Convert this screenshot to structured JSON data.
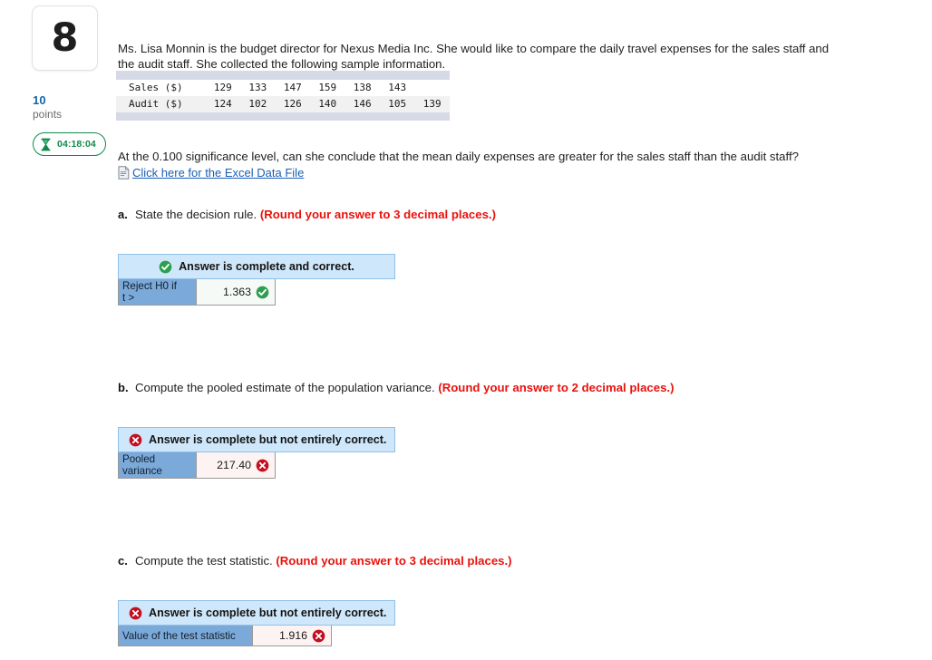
{
  "left_rail": {
    "question_number": "8",
    "points_value": "10",
    "points_label": "points",
    "timer": "04:18:04",
    "timer_icon": "hourglass-icon"
  },
  "main": {
    "intro_paragraph": "Ms. Lisa Monnin is the budget director for Nexus Media Inc. She would like to compare the daily travel expenses for the sales staff and the audit staff. She collected the following sample information.",
    "significance_question": "At the 0.100 significance level, can she conclude that the mean daily expenses are greater for the sales staff than the audit staff?",
    "excel_link": {
      "text": " Click here for the Excel Data File",
      "icon": "document-icon"
    }
  },
  "data_table": {
    "rows": [
      {
        "label": "Sales ($)",
        "values": [
          "129",
          "133",
          "147",
          "159",
          "138",
          "143",
          ""
        ]
      },
      {
        "label": "Audit ($)",
        "values": [
          "124",
          "102",
          "126",
          "140",
          "146",
          "105",
          "139"
        ]
      }
    ]
  },
  "parts": [
    {
      "letter": "a.",
      "prompt": "State the decision rule. ",
      "round_note": "(Round your answer to 3 decimal places.)",
      "status_text": "Answer is complete and correct.",
      "status_type": "correct",
      "status_icon": "check-circle-icon",
      "field_label": "Reject H0 if t >",
      "field_label_line1": "Reject H0 if",
      "field_label_line2": "t >",
      "field_value": "1.363",
      "value_icon": "check-circle-icon"
    },
    {
      "letter": "b.",
      "prompt": "Compute the pooled estimate of the population variance. ",
      "round_note": "(Round your answer to 2 decimal places.)",
      "status_text": "Answer is complete but not entirely correct.",
      "status_type": "incorrect",
      "status_icon": "x-circle-icon",
      "field_label_line1": "Pooled",
      "field_label_line2": "variance",
      "field_value": "217.40",
      "value_icon": "x-circle-icon"
    },
    {
      "letter": "c.",
      "prompt": "Compute the test statistic. ",
      "round_note": "(Round your answer to 3 decimal places.)",
      "status_text": "Answer is complete but not entirely correct.",
      "status_type": "incorrect",
      "status_icon": "x-circle-icon",
      "field_label_line1": "Value of the test statistic",
      "field_label_line2": "",
      "field_value": "1.916",
      "value_icon": "x-circle-icon"
    }
  ],
  "colors": {
    "banner_bg": "#cfe7fa",
    "banner_border": "#8fc0e8",
    "label_cell": "#7aa9da",
    "correct_green": "#2e9e4f",
    "incorrect_red": "#c40f1f",
    "link_blue": "#1a5fb4",
    "round_note_red": "#e8120c",
    "points_blue": "#1565a7",
    "timer_green": "#0f8a4a",
    "table_bar": "#d6dae6"
  }
}
